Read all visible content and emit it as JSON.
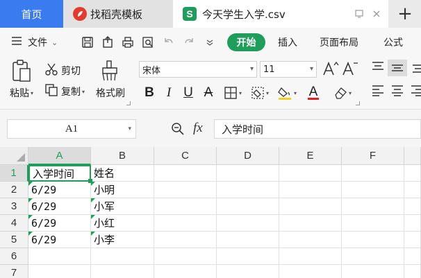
{
  "tabs": {
    "home": "首页",
    "template": "找稻壳模板",
    "file": "今天学生入学.csv"
  },
  "menu": {
    "file_menu": "文件",
    "tab_start": "开始",
    "tab_insert": "插入",
    "tab_page_layout": "页面布局",
    "tab_formula": "公式"
  },
  "ribbon": {
    "paste": "粘贴",
    "cut": "剪切",
    "copy": "复制",
    "format_painter": "格式刷",
    "font_name": "宋体",
    "font_size": "11"
  },
  "formula_bar": {
    "cell_ref": "A1",
    "fx_label": "fx",
    "content": "入学时间"
  },
  "grid": {
    "columns": [
      "A",
      "B",
      "C",
      "D",
      "E",
      "F"
    ],
    "rows": [
      "1",
      "2",
      "3",
      "4",
      "5",
      "6",
      "7"
    ],
    "cells": [
      [
        "入学时间",
        "姓名"
      ],
      [
        "6/29",
        "小明"
      ],
      [
        "6/29",
        "小军"
      ],
      [
        "6/29",
        "小红"
      ],
      [
        "6/29",
        "小李"
      ]
    ]
  },
  "colors": {
    "accent": "#1e9e5a",
    "home_tab": "#3a7cf0",
    "logo_red": "#e33b2e"
  }
}
